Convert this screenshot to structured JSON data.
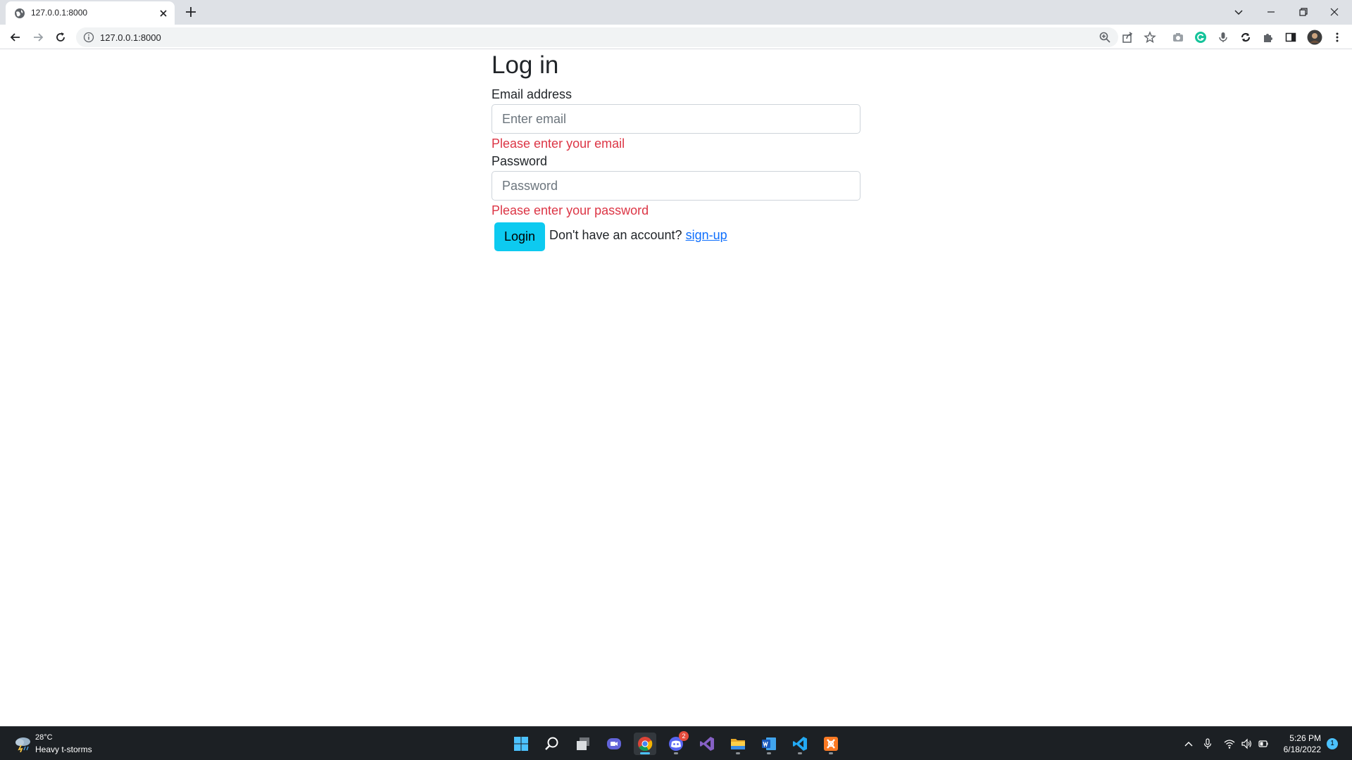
{
  "browser": {
    "tab_title": "127.0.0.1:8000",
    "url": "127.0.0.1:8000"
  },
  "form": {
    "heading": "Log in",
    "email_label": "Email address",
    "email_placeholder": "Enter email",
    "email_error": "Please enter your email",
    "password_label": "Password",
    "password_placeholder": "Password",
    "password_error": "Please enter your password",
    "login_button": "Login",
    "signup_prompt": "Don't have an account?",
    "signup_link": "sign-up"
  },
  "taskbar": {
    "weather_temp": "28°C",
    "weather_desc": "Heavy t-storms",
    "apps": [
      "start-icon",
      "search-icon",
      "task-view-icon",
      "chat-icon",
      "chrome-icon",
      "discord-icon",
      "visual-studio-icon",
      "file-explorer-icon",
      "word-icon",
      "vscode-icon",
      "xampp-icon"
    ],
    "discord_badge": "2",
    "time": "5:26 PM",
    "date": "6/18/2022",
    "notification_count": "1"
  },
  "colors": {
    "accent_button": "#0dcaf0",
    "error_text": "#dc3545",
    "link": "#0d6efd"
  }
}
